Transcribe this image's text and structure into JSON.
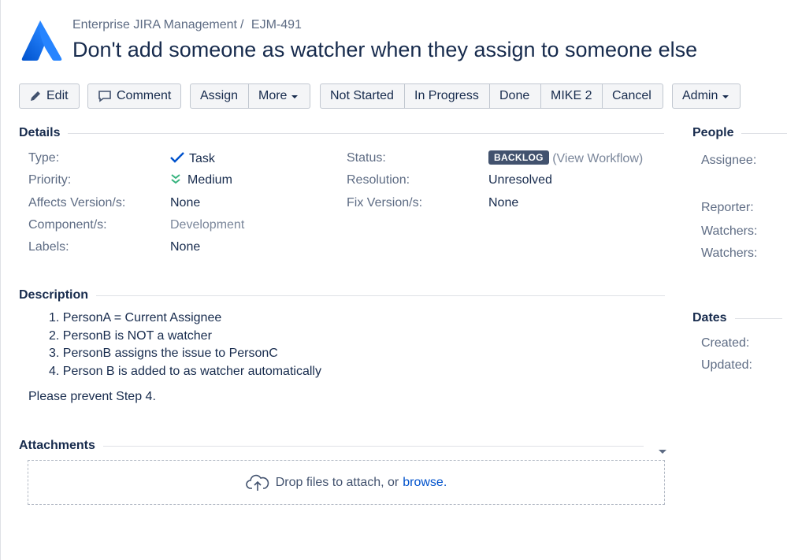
{
  "header": {
    "project": "Enterprise JIRA Management",
    "separator": "/",
    "issue_key": "EJM-491",
    "summary": "Don't add someone as watcher when they assign to someone else"
  },
  "toolbar": {
    "edit": "Edit",
    "comment": "Comment",
    "assign": "Assign",
    "more": "More",
    "not_started": "Not Started",
    "in_progress": "In Progress",
    "done": "Done",
    "mike2": "MIKE 2",
    "cancel": "Cancel",
    "admin": "Admin"
  },
  "details": {
    "heading": "Details",
    "type_label": "Type:",
    "type_value": "Task",
    "priority_label": "Priority:",
    "priority_value": "Medium",
    "affects_label": "Affects Version/s:",
    "affects_value": "None",
    "component_label": "Component/s:",
    "component_value": "Development",
    "labels_label": "Labels:",
    "labels_value": "None",
    "status_label": "Status:",
    "status_value": "BACKLOG",
    "view_workflow": "View Workflow",
    "resolution_label": "Resolution:",
    "resolution_value": "Unresolved",
    "fix_label": "Fix Version/s:",
    "fix_value": "None"
  },
  "description": {
    "heading": "Description",
    "steps": [
      "1. PersonA = Current Assignee",
      "2. PersonB is NOT a watcher",
      "3. PersonB assigns the issue to PersonC",
      "4. Person B is added to as watcher automatically"
    ],
    "note": "Please prevent Step 4."
  },
  "attachments": {
    "heading": "Attachments",
    "drop_text": "Drop files to attach, or",
    "browse": "browse."
  },
  "people": {
    "heading": "People",
    "assignee_label": "Assignee:",
    "reporter_label": "Reporter:",
    "watchers_label_1": "Watchers:",
    "watchers_label_2": "Watchers:"
  },
  "dates": {
    "heading": "Dates",
    "created_label": "Created:",
    "updated_label": "Updated:"
  },
  "colors": {
    "brand": "#2684ff",
    "status_lozenge": "#42526e",
    "link": "#0052cc",
    "check": "#0052cc",
    "priority_medium": "#36b37e"
  },
  "icons": [
    "jira-logo-icon",
    "pencil-icon",
    "comment-icon",
    "caret-down-icon",
    "checkmark-icon",
    "priority-medium-icon",
    "cloud-upload-icon"
  ]
}
